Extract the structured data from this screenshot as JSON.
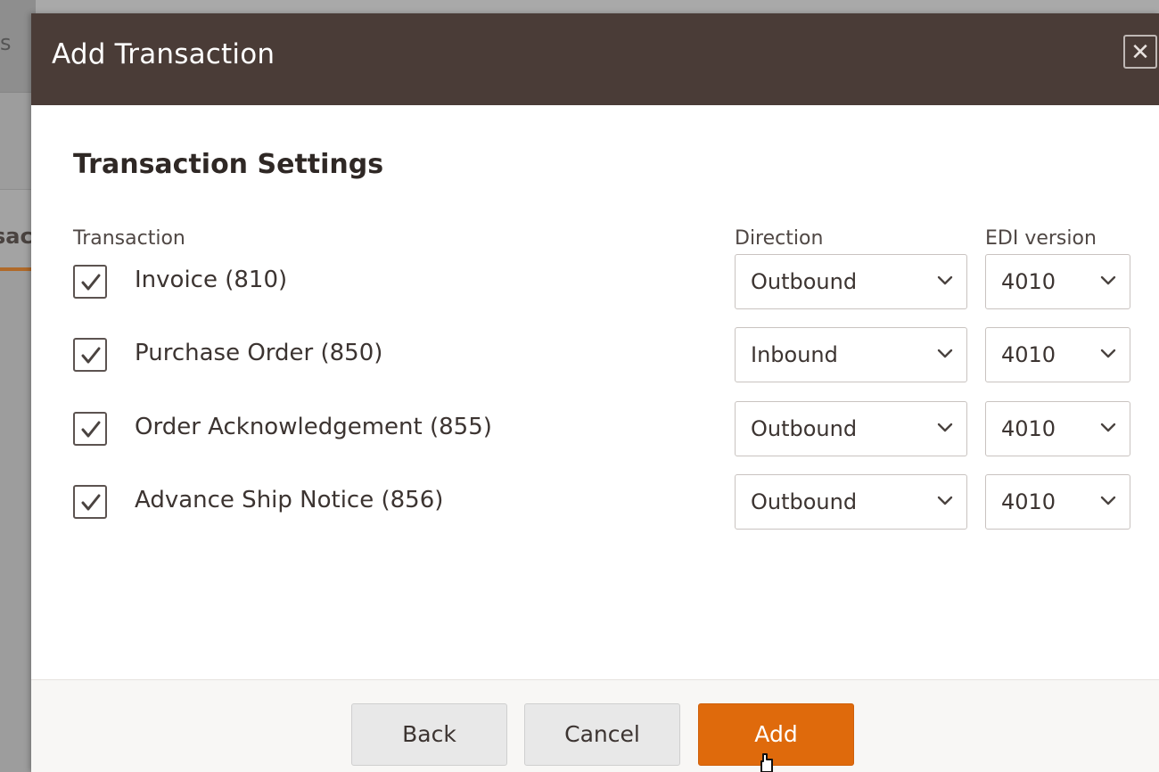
{
  "background": {
    "glyph": "s",
    "tab_fragment": "sac"
  },
  "modal": {
    "title": "Add Transaction",
    "close_icon": "close-icon",
    "section_title": "Transaction Settings",
    "columns": {
      "transaction": "Transaction",
      "direction": "Direction",
      "edi_version": "EDI version"
    },
    "transactions": [
      {
        "label": "Invoice (810)",
        "checked": true,
        "direction": "Outbound",
        "edi_version": "4010"
      },
      {
        "label": "Purchase Order (850)",
        "checked": true,
        "direction": "Inbound",
        "edi_version": "4010"
      },
      {
        "label": "Order Acknowledgement (855)",
        "checked": true,
        "direction": "Outbound",
        "edi_version": "4010"
      },
      {
        "label": "Advance Ship Notice (856)",
        "checked": true,
        "direction": "Outbound",
        "edi_version": "4010"
      }
    ],
    "footer": {
      "back_label": "Back",
      "cancel_label": "Cancel",
      "add_label": "Add"
    }
  },
  "colors": {
    "header_bg": "#4a3c37",
    "primary_button": "#df6a0c",
    "secondary_button": "#e8e8e8"
  }
}
